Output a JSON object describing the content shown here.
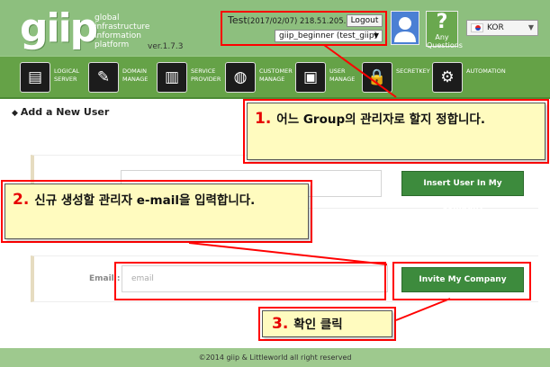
{
  "header": {
    "logo_text": "giip",
    "logo_sub": [
      "global",
      "infrastructure",
      "information",
      "platform"
    ],
    "version": "ver.1.7.3",
    "user_name": "Test",
    "user_info": "(2017/02/07) 218.51.205.204",
    "logout_label": "Logout",
    "group_selected": "giip_beginner (test_giip)",
    "help_symbol": "?",
    "help_label_1": "Any",
    "help_label_2": "Questions",
    "lang_selected": "KOR"
  },
  "nav": {
    "items": [
      {
        "label": "LOGICAL\nSERVER",
        "icon": "server-icon",
        "glyph": "▤"
      },
      {
        "label": "DOMAIN\nMANAGE",
        "icon": "brush-icon",
        "glyph": "✎"
      },
      {
        "label": "SERVICE\nPROVIDER",
        "icon": "building-icon",
        "glyph": "▥"
      },
      {
        "label": "CUSTOMER\nMANAGE",
        "icon": "globe-icon",
        "glyph": "◍"
      },
      {
        "label": "USER\nMANAGE",
        "icon": "user-frame-icon",
        "glyph": "▣"
      },
      {
        "label": "SECRETKEY",
        "icon": "lock-icon",
        "glyph": "🔒"
      },
      {
        "label": "AUTOMATION",
        "icon": "gear-icon",
        "glyph": "⚙"
      }
    ]
  },
  "main": {
    "page_title": "Add a New User",
    "insert_button": "Insert User In My Company",
    "email_label": "Email :",
    "email_placeholder": "email",
    "invite_button": "Invite My Company"
  },
  "footer": {
    "copyright": "©2014 giip & Littleworld all right reserved"
  },
  "annotations": [
    {
      "number": "1.",
      "text": "어느 Group의 관리자로 할지 정합니다."
    },
    {
      "number": "2.",
      "text": "신규 생성할 관리자 e-mail을 입력합니다."
    },
    {
      "number": "3.",
      "text": "확인 클릭"
    }
  ],
  "colors": {
    "header_bg": "#8dbf7e",
    "nav_bg": "#65a247",
    "button_green": "#3d8b3d",
    "annotation_red": "#ff0000",
    "callout_bg": "#fffbbf"
  }
}
